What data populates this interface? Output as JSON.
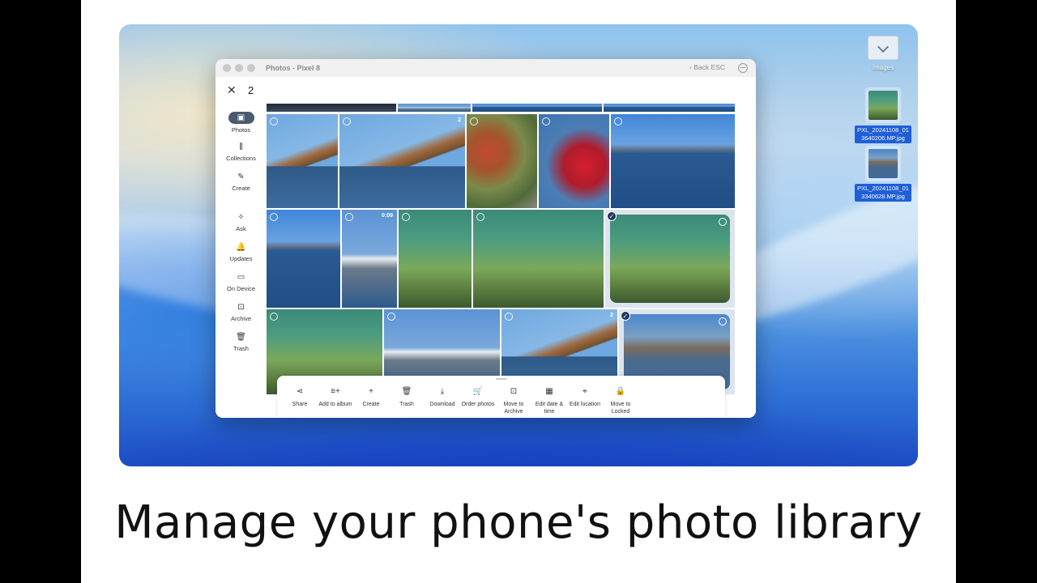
{
  "window": {
    "title": "Photos - Pixel 8",
    "back_label": "Back ESC",
    "close_symbol": "✕",
    "selected_count": "2"
  },
  "sidebar": {
    "items": [
      {
        "label": "Photos",
        "icon": "photos-icon",
        "glyph": "▣",
        "active": true
      },
      {
        "label": "Collections",
        "icon": "collections-icon",
        "glyph": "⫼"
      },
      {
        "label": "Create",
        "icon": "brush-icon",
        "glyph": "✎"
      },
      {
        "label": "Ask",
        "icon": "ask-sparkle-icon",
        "glyph": "✧"
      },
      {
        "label": "Updates",
        "icon": "bell-icon",
        "glyph": "🔔"
      },
      {
        "label": "On Device",
        "icon": "folder-icon",
        "glyph": "▭"
      },
      {
        "label": "Archive",
        "icon": "archive-icon",
        "glyph": "⊡"
      },
      {
        "label": "Trash",
        "icon": "trash-icon",
        "glyph": "🗑"
      }
    ]
  },
  "grid": {
    "badges": {
      "stack_2a": "2",
      "video_duration": "0:09",
      "stack_2b": "2"
    }
  },
  "actions": [
    {
      "label": "Share",
      "icon": "share-icon",
      "glyph": "⋖"
    },
    {
      "label": "Add to album",
      "icon": "add-to-album-icon",
      "glyph": "≡+"
    },
    {
      "label": "Create",
      "icon": "plus-icon",
      "glyph": "+"
    },
    {
      "label": "Trash",
      "icon": "trash-icon",
      "glyph": "🗑"
    },
    {
      "label": "Download",
      "icon": "download-icon",
      "glyph": "⤓"
    },
    {
      "label": "Order photos",
      "icon": "cart-icon",
      "glyph": "🛒"
    },
    {
      "label": "Move to Archive",
      "icon": "archive-icon",
      "glyph": "⊡"
    },
    {
      "label": "Edit date & time",
      "icon": "calendar-icon",
      "glyph": "▦"
    },
    {
      "label": "Edit location",
      "icon": "location-icon",
      "glyph": "⌖"
    },
    {
      "label": "Move to Locked",
      "icon": "lock-icon",
      "glyph": "🔒"
    }
  ],
  "desktop": {
    "folder_label": "Images",
    "files": [
      {
        "name": "PXL_20241108_013640206.MP.jpg",
        "line1": "PXL_20241108_01",
        "line2": "3640206.MP.jpg"
      },
      {
        "name": "PXL_20241108_013340628.MP.jpg",
        "line1": "PXL_20241108_01",
        "line2": "3340628.MP.jpg"
      }
    ]
  },
  "caption": "Manage your phone's photo library",
  "colors": {
    "accent_selected": "#1f3a5f",
    "file_label_bg": "#1f5fd6",
    "active_nav": "#4b5a6e"
  }
}
